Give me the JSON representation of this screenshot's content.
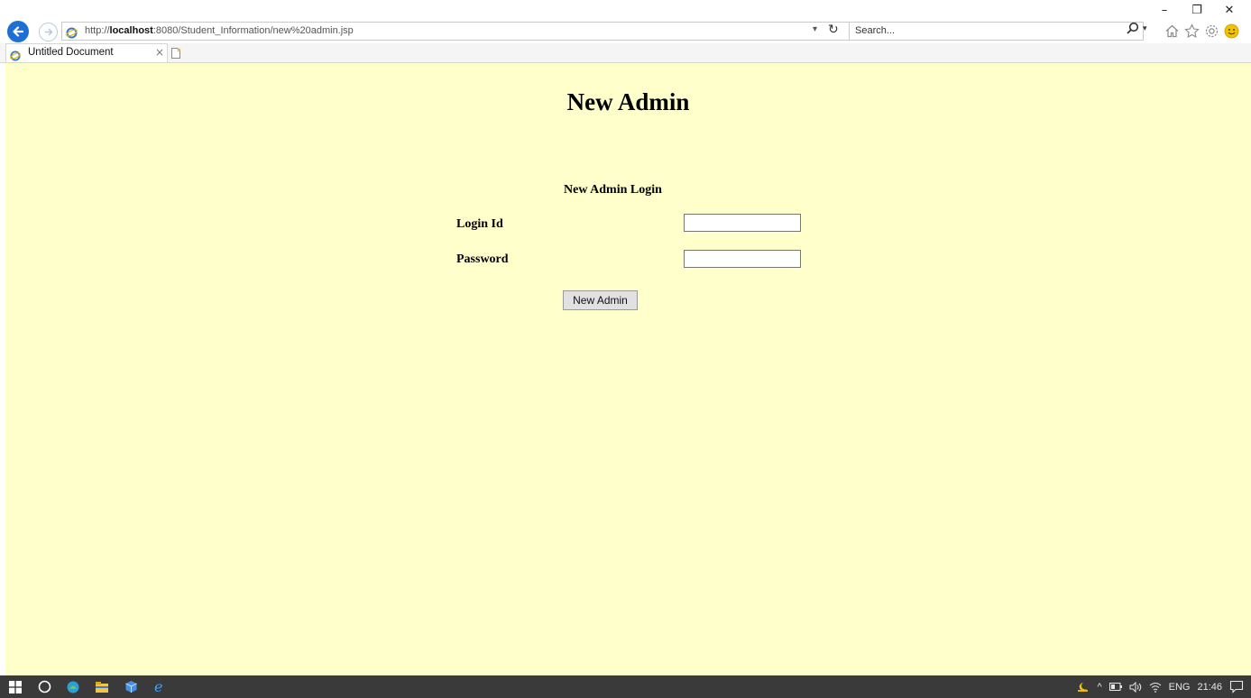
{
  "window": {
    "minimize_glyph": "–",
    "restore_glyph": "❐",
    "close_glyph": "✕"
  },
  "address_bar": {
    "url_prefix": "http://",
    "url_host": "localhost",
    "url_rest": ":8080/Student_Information/new%20admin.jsp",
    "dropdown_glyph": "▾",
    "refresh_glyph": "↻"
  },
  "search": {
    "placeholder": "Search...",
    "dropdown_glyph": "▾"
  },
  "tabs": [
    {
      "title": "Untitled Document",
      "close_glyph": "×"
    }
  ],
  "page": {
    "title": "New Admin",
    "form_title": "New Admin Login",
    "fields": {
      "login_id_label": "Login Id",
      "login_id_value": "",
      "password_label": "Password",
      "password_value": ""
    },
    "submit_label": "New Admin",
    "background_color": "#ffffcc"
  },
  "taskbar": {
    "language": "ENG",
    "time": "21:46",
    "tray_up_glyph": "^"
  },
  "colors": {
    "browser_accent": "#1e6fd4",
    "taskbar": "#3a3a3a",
    "smiley": "#f2c200"
  }
}
